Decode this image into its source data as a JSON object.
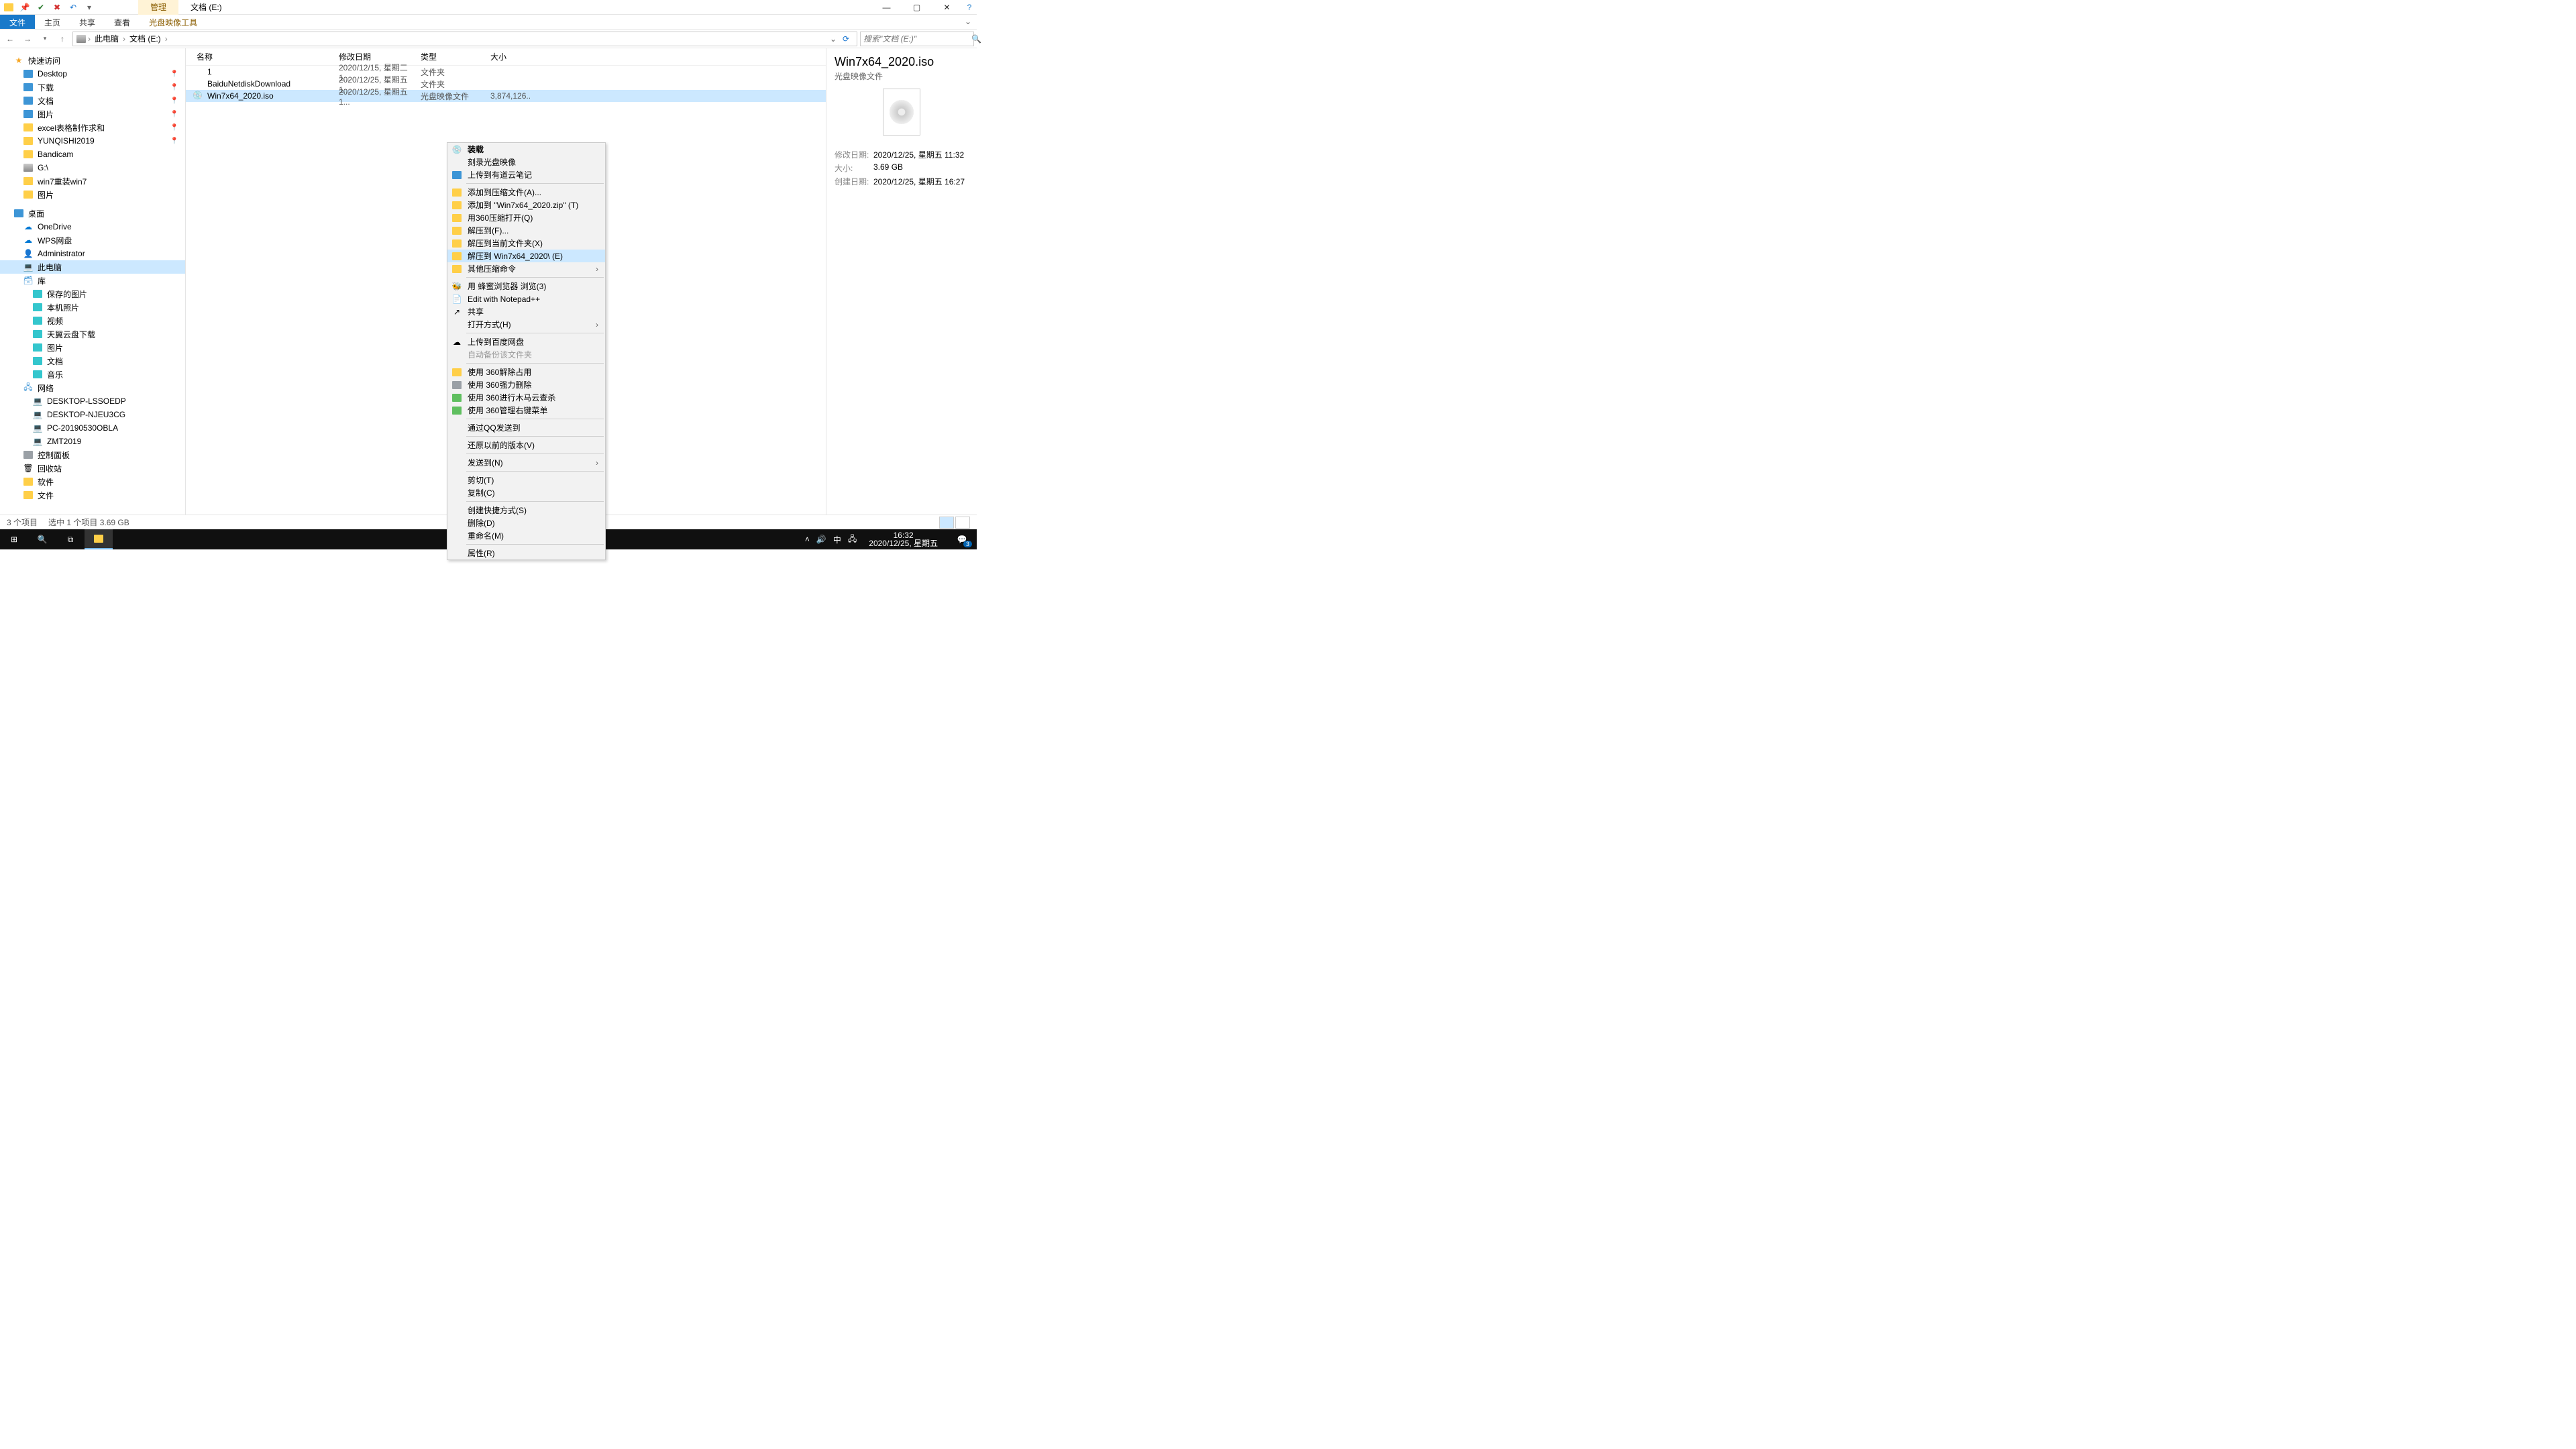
{
  "window": {
    "title_tab_tool": "管理",
    "title_tab_path": "文档 (E:)"
  },
  "ribbon": {
    "file": "文件",
    "home": "主页",
    "share": "共享",
    "view": "查看",
    "disc_tools": "光盘映像工具"
  },
  "nav": {
    "crumbs": [
      "此电脑",
      "文档 (E:)"
    ],
    "search_placeholder": "搜索\"文档 (E:)\""
  },
  "tree": {
    "quick": "快速访问",
    "quick_items": [
      "Desktop",
      "下载",
      "文档",
      "图片",
      "excel表格制作求和",
      "YUNQISHI2019",
      "Bandicam",
      "G:\\",
      "win7重装win7",
      "图片"
    ],
    "desktop": "桌面",
    "desktop_items": [
      "OneDrive",
      "WPS网盘",
      "Administrator",
      "此电脑",
      "库"
    ],
    "lib_items": [
      "保存的图片",
      "本机照片",
      "视频",
      "天翼云盘下载",
      "图片",
      "文档",
      "音乐"
    ],
    "network": "网络",
    "net_items": [
      "DESKTOP-LSSOEDP",
      "DESKTOP-NJEU3CG",
      "PC-20190530OBLA",
      "ZMT2019"
    ],
    "cpanel": "控制面板",
    "recycle": "回收站",
    "soft": "软件",
    "files": "文件"
  },
  "columns": {
    "name": "名称",
    "date": "修改日期",
    "type": "类型",
    "size": "大小"
  },
  "rows": [
    {
      "name": "1",
      "date": "2020/12/15, 星期二 1...",
      "type": "文件夹",
      "size": ""
    },
    {
      "name": "BaiduNetdiskDownload",
      "date": "2020/12/25, 星期五 1...",
      "type": "文件夹",
      "size": ""
    },
    {
      "name": "Win7x64_2020.iso",
      "date": "2020/12/25, 星期五 1...",
      "type": "光盘映像文件",
      "size": "3,874,126..."
    }
  ],
  "ctx": {
    "g1": [
      "装载",
      "刻录光盘映像",
      "上传到有道云笔记"
    ],
    "g2": [
      "添加到压缩文件(A)...",
      "添加到 \"Win7x64_2020.zip\" (T)",
      "用360压缩打开(Q)",
      "解压到(F)...",
      "解压到当前文件夹(X)",
      "解压到 Win7x64_2020\\ (E)",
      "其他压缩命令"
    ],
    "g3": [
      "用 蜂蜜浏览器 浏览(3)",
      "Edit with Notepad++",
      "共享",
      "打开方式(H)"
    ],
    "g4": [
      "上传到百度网盘",
      "自动备份该文件夹"
    ],
    "g5": [
      "使用 360解除占用",
      "使用 360强力删除",
      "使用 360进行木马云查杀",
      "使用 360管理右键菜单"
    ],
    "g6": [
      "通过QQ发送到"
    ],
    "g7": [
      "还原以前的版本(V)"
    ],
    "g8": [
      "发送到(N)"
    ],
    "g9": [
      "剪切(T)",
      "复制(C)"
    ],
    "g10": [
      "创建快捷方式(S)",
      "删除(D)",
      "重命名(M)"
    ],
    "g11": [
      "属性(R)"
    ]
  },
  "details": {
    "title": "Win7x64_2020.iso",
    "subtitle": "光盘映像文件",
    "meta": {
      "mdate_k": "修改日期:",
      "mdate_v": "2020/12/25, 星期五 11:32",
      "size_k": "大小:",
      "size_v": "3.69 GB",
      "cdate_k": "创建日期:",
      "cdate_v": "2020/12/25, 星期五 16:27"
    }
  },
  "status": {
    "count": "3 个项目",
    "sel": "选中 1 个项目  3.69 GB"
  },
  "taskbar": {
    "tray": {
      "ime": "中",
      "time": "16:32",
      "date": "2020/12/25, 星期五",
      "badge": "3"
    }
  }
}
